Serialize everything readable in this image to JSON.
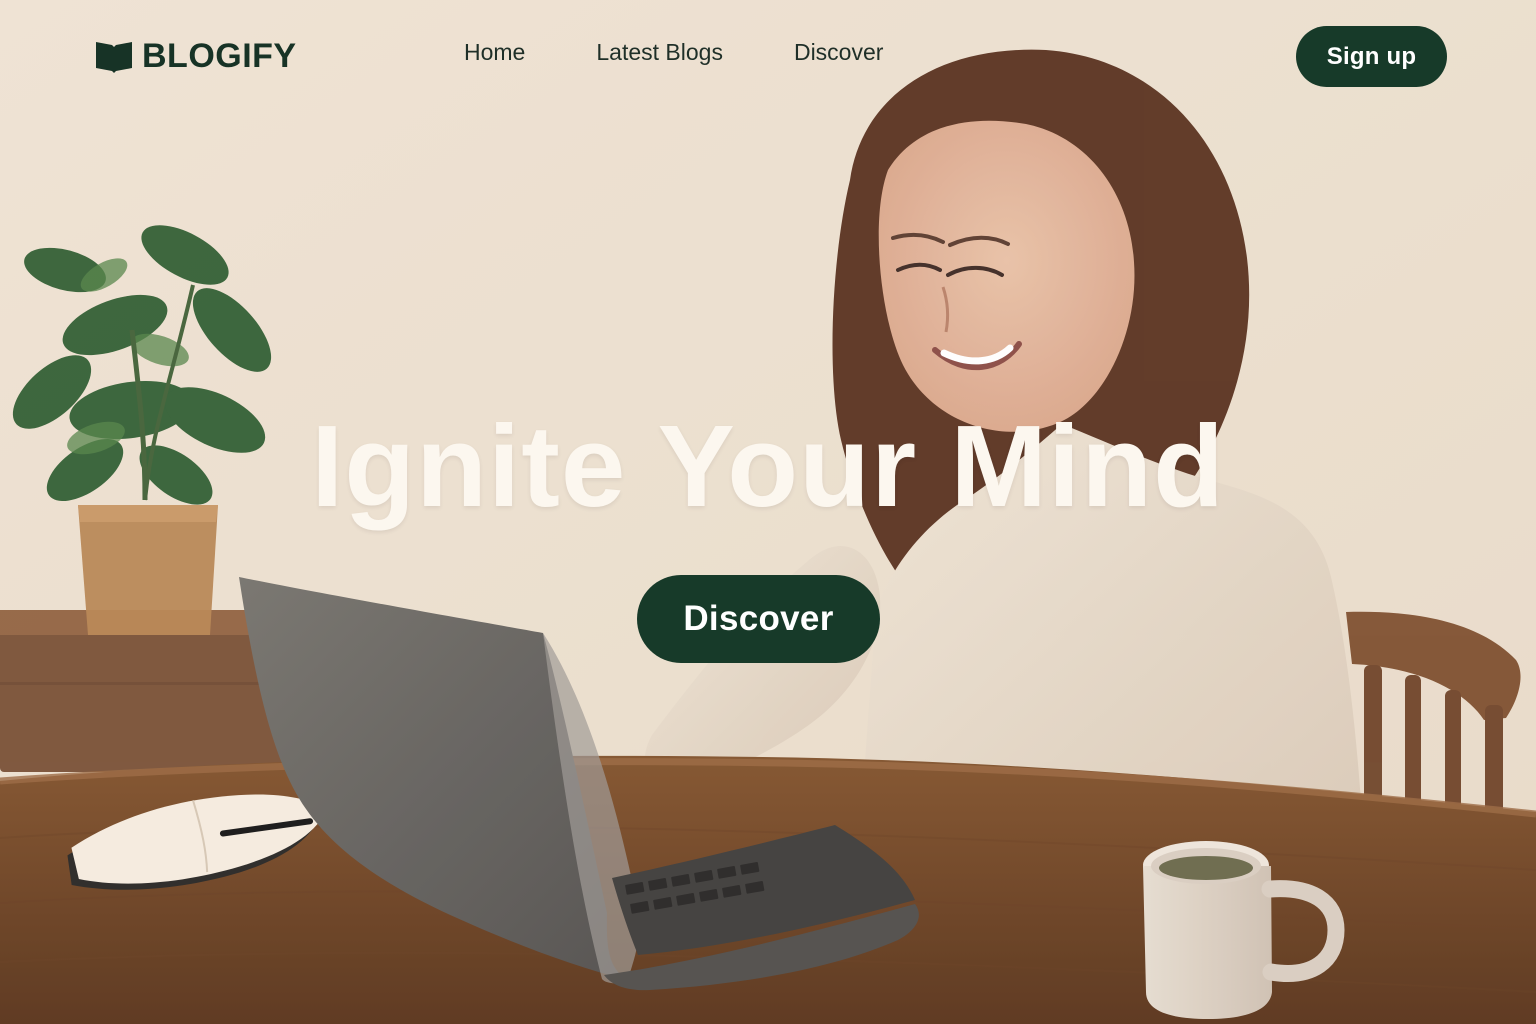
{
  "brand": {
    "name": "BLOGIFY",
    "icon": "book-icon"
  },
  "nav": {
    "items": [
      {
        "label": "Home"
      },
      {
        "label": "Latest Blogs"
      },
      {
        "label": "Discover"
      }
    ],
    "signup_label": "Sign up"
  },
  "hero": {
    "title": "Ignite Your Mind",
    "button_label": "Discover"
  },
  "colors": {
    "background": "#efe5d6",
    "brand_green": "#173a29",
    "heading_light": "#fcf7ef",
    "nav_text": "#1f2f28"
  }
}
